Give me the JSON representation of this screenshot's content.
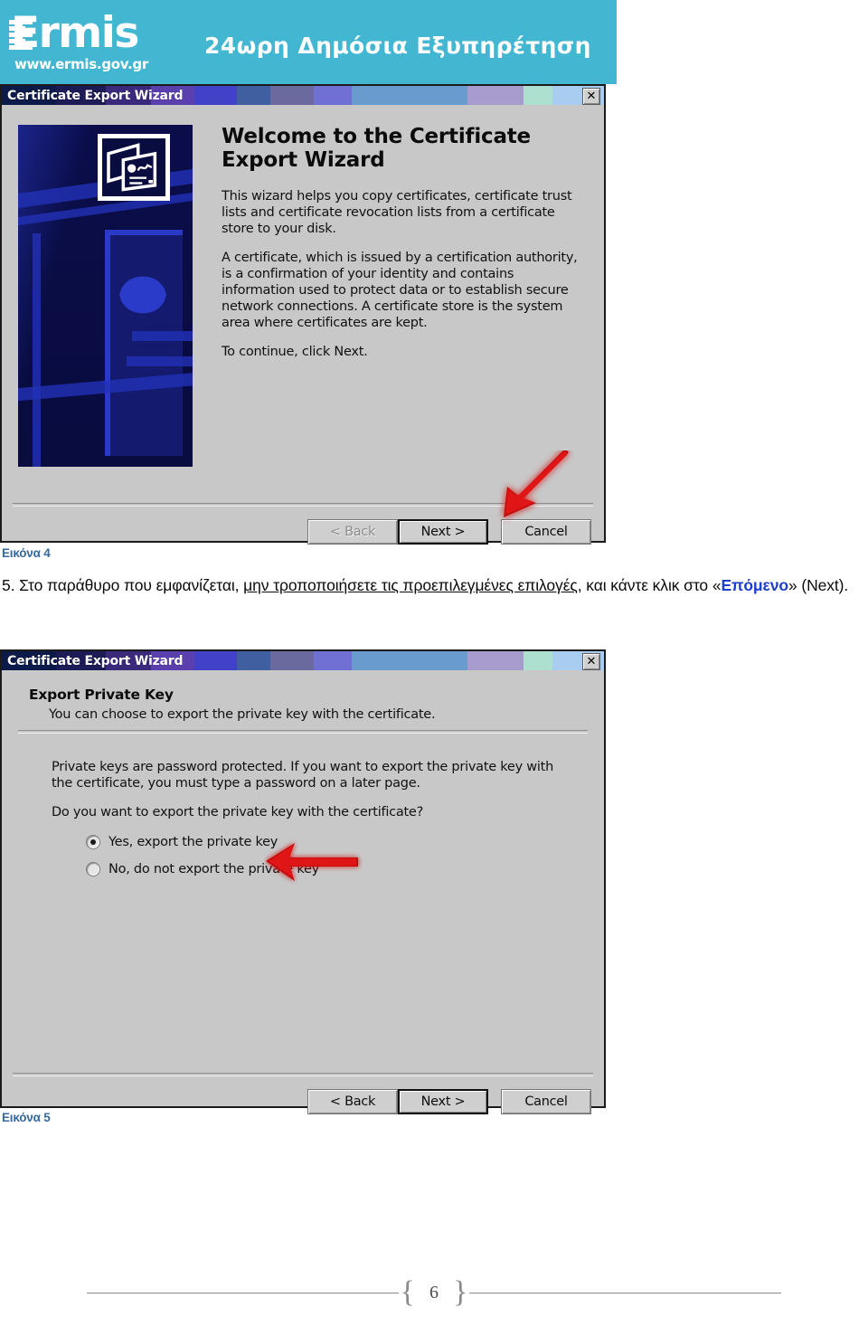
{
  "banner": {
    "logo_word": "Ermis",
    "logo_url": "www.ermis.gov.gr",
    "tagline": "24ωρη Δημόσια Εξυπηρέτηση",
    "background_color": "#43b6d2"
  },
  "dialog_welcome": {
    "titlebar": {
      "title": "Certificate Export Wizard",
      "close_label": "✕",
      "band_colors": [
        "#0c1a4a",
        "#1c1d5e",
        "#3a2a7a",
        "#5b3fae",
        "#3f4fd2",
        "#41609f",
        "#6a6a9e",
        "#6c6ccc",
        "#6a9ace",
        "#6fa0d2",
        "#a99ccc",
        "#aee0cf",
        "#a9cdf0"
      ]
    },
    "heading": "Welcome to the Certificate Export Wizard",
    "paragraphs": [
      "This wizard helps you copy certificates, certificate trust lists and certificate revocation lists from a certificate store to your disk.",
      "A certificate, which is issued by a certification authority, is a confirmation of your identity and contains information used to protect data or to establish secure network connections. A certificate store is the system area where certificates are kept.",
      "To continue, click Next."
    ],
    "buttons": {
      "back": "< Back",
      "next": "Next >",
      "cancel": "Cancel"
    },
    "artwork_icon": "certificate-icon"
  },
  "dialog_private_key": {
    "titlebar": {
      "title": "Certificate Export Wizard",
      "close_label": "✕"
    },
    "heading": "Export Private Key",
    "subheading": "You can choose to export the private key with the certificate.",
    "paragraphs": [
      "Private keys are password protected. If you want to export the private key with the certificate, you must type a password on a later page.",
      "Do you want to export the private key with the certificate?"
    ],
    "options": [
      {
        "label": "Yes, export the private key",
        "checked": true
      },
      {
        "label": "No, do not export the private key",
        "checked": false
      }
    ],
    "buttons": {
      "back": "< Back",
      "next": "Next >",
      "cancel": "Cancel"
    }
  },
  "annotations": {
    "arrow_color": "#c81515",
    "arrow_next_target": "Next >",
    "arrow_yes_target": "Yes, export the private key"
  },
  "document": {
    "caption_4": "Εικόνα 4",
    "caption_5": "Εικόνα 5",
    "step_number": "5.",
    "step_text_1": "Στο παράθυρο που εμφανίζεται, ",
    "step_text_underlined": "μην τροποποιήσετε τις προεπιλεγμένες επιλογές",
    "step_text_2": ", και κάντε κλικ στο «",
    "step_text_blue": "Επόμενο",
    "step_text_3": "» (Next).",
    "page_number": "6"
  }
}
